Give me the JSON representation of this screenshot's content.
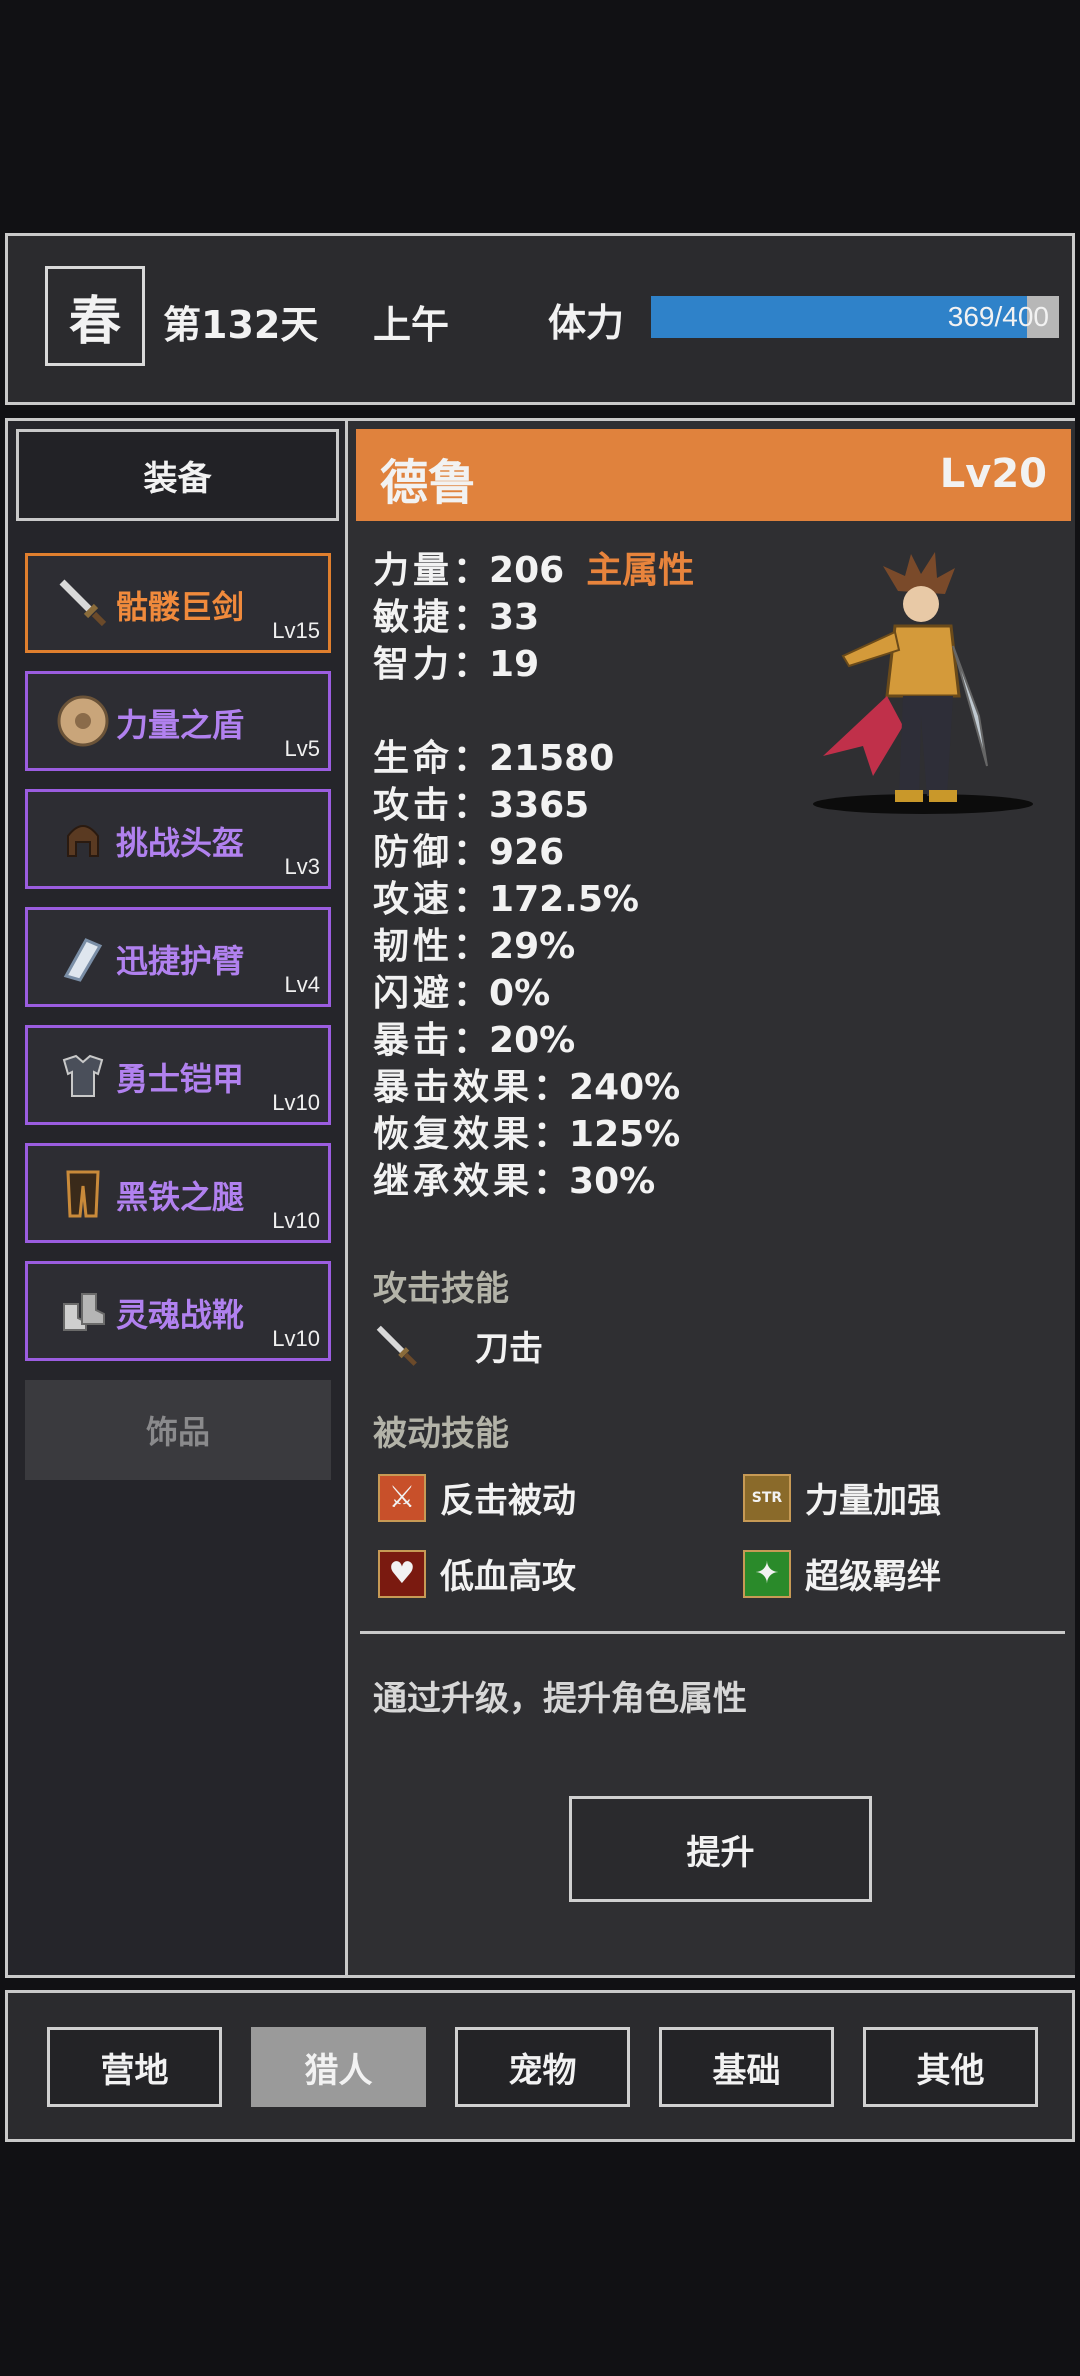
{
  "status": {
    "season": "春",
    "day": "第132天",
    "time": "上午",
    "stamina_label": "体力",
    "stamina_text": "369/400",
    "stamina_fraction": 0.9225
  },
  "equipment": {
    "title": "装备",
    "items": [
      {
        "name": "骷髅巨剑",
        "level": "Lv15",
        "icon": "sword-icon"
      },
      {
        "name": "力量之盾",
        "level": "Lv5",
        "icon": "shield-icon"
      },
      {
        "name": "挑战头盔",
        "level": "Lv3",
        "icon": "helmet-icon"
      },
      {
        "name": "迅捷护臂",
        "level": "Lv4",
        "icon": "bracer-icon"
      },
      {
        "name": "勇士铠甲",
        "level": "Lv10",
        "icon": "armor-icon"
      },
      {
        "name": "黑铁之腿",
        "level": "Lv10",
        "icon": "leg-armor-icon"
      },
      {
        "name": "灵魂战靴",
        "level": "Lv10",
        "icon": "boots-icon"
      }
    ],
    "accessory_label": "饰品"
  },
  "character": {
    "name": "德鲁",
    "level": "Lv20",
    "primary_stats": [
      {
        "key": "力量",
        "value": "206",
        "tag": "主属性"
      },
      {
        "key": "敏捷",
        "value": "33"
      },
      {
        "key": "智力",
        "value": "19"
      }
    ],
    "combat_stats": [
      {
        "key": "生命",
        "value": "21580"
      },
      {
        "key": "攻击",
        "value": "3365"
      },
      {
        "key": "防御",
        "value": "926"
      },
      {
        "key": "攻速",
        "value": "172.5%"
      },
      {
        "key": "韧性",
        "value": "29%"
      },
      {
        "key": "闪避",
        "value": "0%"
      },
      {
        "key": "暴击",
        "value": "20%"
      },
      {
        "key": "暴击效果",
        "value": "240%"
      },
      {
        "key": "恢复效果",
        "value": "125%"
      },
      {
        "key": "继承效果",
        "value": "30%"
      }
    ],
    "separator": "：",
    "attack_skill_title": "攻击技能",
    "attack_skill": "刀击",
    "passive_skill_title": "被动技能",
    "passive_skills": [
      "反击被动",
      "力量加强",
      "低血高攻",
      "超级羁绊"
    ],
    "upgrade_text": "通过升级，提升角色属性",
    "upgrade_button": "提升"
  },
  "nav": {
    "tabs": [
      "营地",
      "猎人",
      "宠物",
      "基础",
      "其他"
    ],
    "active": "猎人"
  },
  "colors": {
    "accent_orange": "#e0823d",
    "epic_purple": "#9b5de0",
    "stamina_blue": "#2f82c9"
  }
}
